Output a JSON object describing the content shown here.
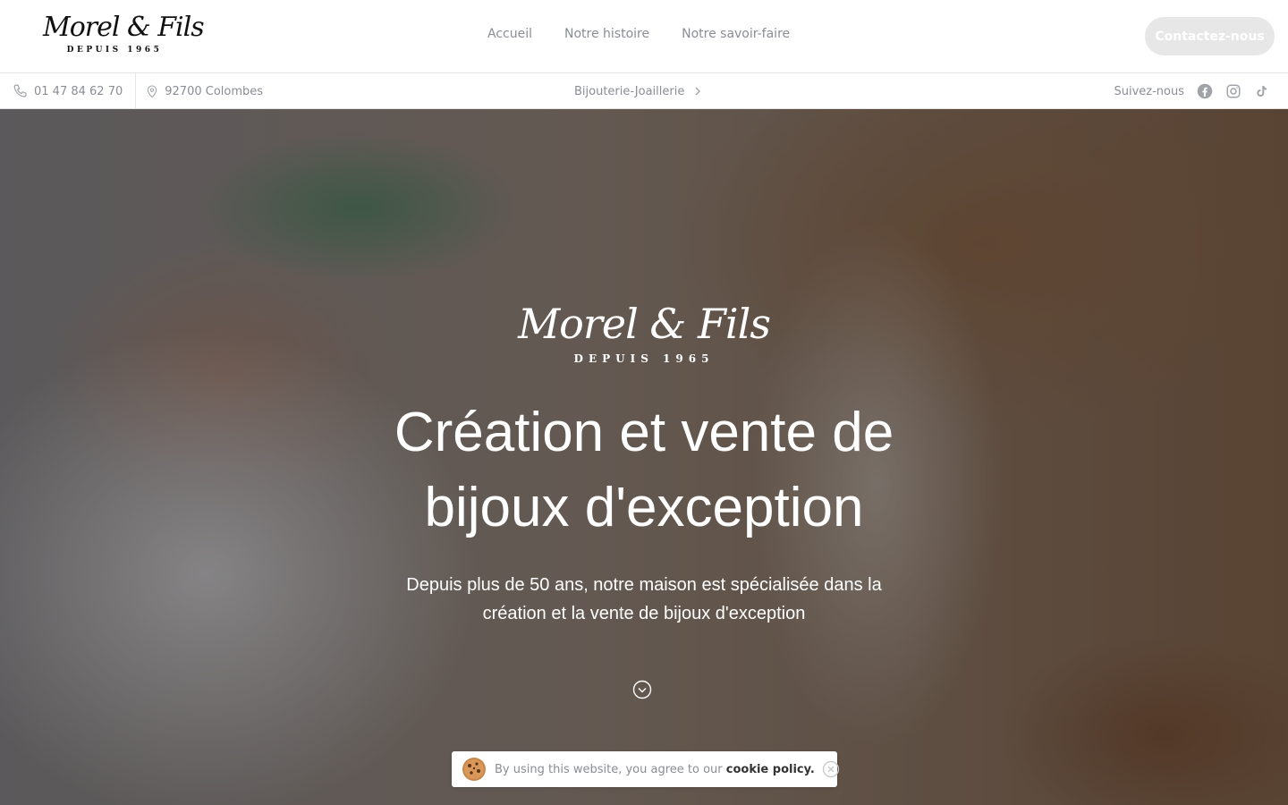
{
  "header": {
    "logo": {
      "script": "Morel & Fils",
      "since": "DEPUIS 1965"
    },
    "nav": [
      {
        "label": "Accueil"
      },
      {
        "label": "Notre histoire"
      },
      {
        "label": "Notre savoir-faire"
      }
    ],
    "contact_button": "Contactez-nous"
  },
  "infobar": {
    "phone": "01 47 84 62 70",
    "location": "92700 Colombes",
    "category": "Bijouterie-Joaillerie",
    "follow_label": "Suivez-nous",
    "socials": [
      "facebook-icon",
      "instagram-icon",
      "tiktok-icon"
    ]
  },
  "hero": {
    "logo": {
      "script": "Morel & Fils",
      "since": "DEPUIS 1965"
    },
    "title_line1": "Création et vente de",
    "title_line2": "bijoux d'exception",
    "subtitle_line1": "Depuis plus de 50 ans, notre maison est spécialisée dans la",
    "subtitle_line2": "création et la vente de bijoux d'exception"
  },
  "cookie": {
    "text": "By using this website, you agree to our",
    "link": "cookie policy."
  },
  "colors": {
    "muted_text": "#8a8d93",
    "button_bg": "#e7e7e7",
    "border": "#e6e6e6"
  }
}
